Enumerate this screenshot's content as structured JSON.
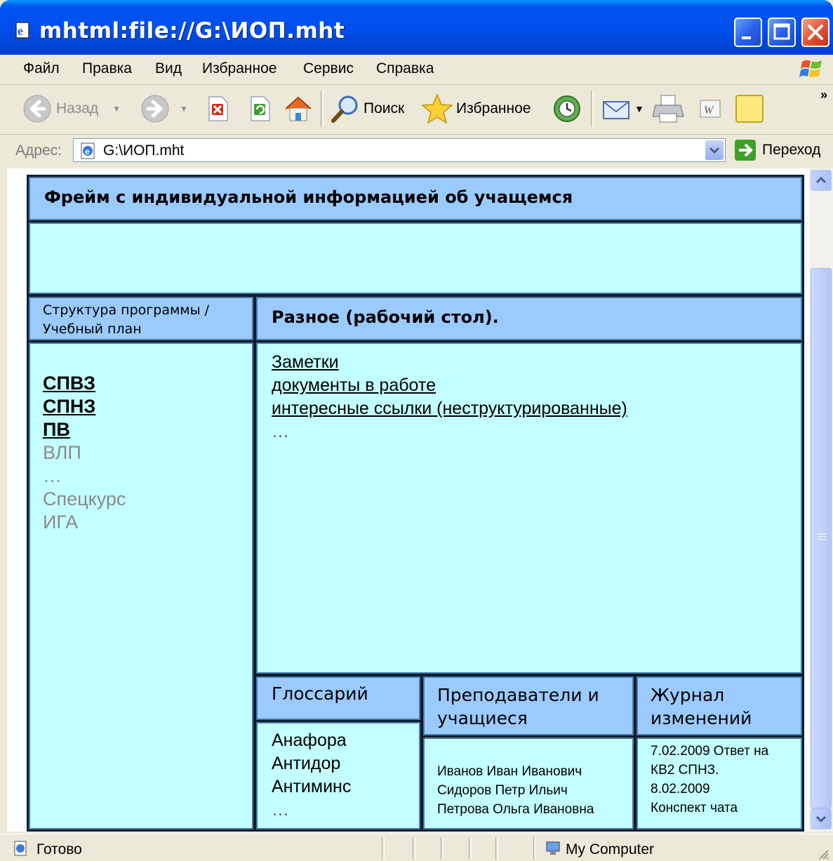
{
  "window": {
    "title": "mhtml:file://G:\\ИОП.mht"
  },
  "menu": [
    {
      "label": "Файл"
    },
    {
      "label": "Правка"
    },
    {
      "label": "Вид"
    },
    {
      "label": "Избранное"
    },
    {
      "label": "Сервис"
    },
    {
      "label": "Справка"
    }
  ],
  "toolbar": {
    "back": "Назад",
    "search": "Поиск",
    "favorites": "Избранное"
  },
  "address": {
    "label": "Адрес:",
    "value": "G:\\ИОП.mht",
    "go": "Переход"
  },
  "page": {
    "top_frame": {
      "title": "Фрейм с индивидуальной информацией об учащемся"
    },
    "left_frame": {
      "title_line1": "Структура программы /",
      "title_line2": "Учебный план",
      "items": [
        "СПВЗ",
        "СПНЗ",
        "ПВ",
        "ВЛП",
        "…",
        "Спецкурс",
        "ИГА"
      ]
    },
    "desk_frame": {
      "title": "Разное (рабочий стол).",
      "links": [
        "Заметки",
        "документы в работе",
        "интересные ссылки (неструктурированные)"
      ],
      "ellipsis": "…"
    },
    "glossary": {
      "title": "Глоссарий",
      "items": [
        "Анафора",
        "Антидор",
        "Антиминс",
        "…"
      ]
    },
    "people": {
      "title_line1": "Преподаватели и",
      "title_line2": "учащиеся",
      "items": [
        "Иванов Иван Иванович",
        "Сидоров Петр Ильич",
        "Петрова Ольга Ивановна"
      ]
    },
    "log": {
      "title_line1": "Журнал",
      "title_line2": "изменений",
      "lines": [
        "7.02.2009 Ответ на",
        "КВ2 СПНЗ.",
        "8.02.2009",
        "Конспект чата"
      ]
    }
  },
  "status": {
    "text": "Готово",
    "zone": "My Computer"
  }
}
